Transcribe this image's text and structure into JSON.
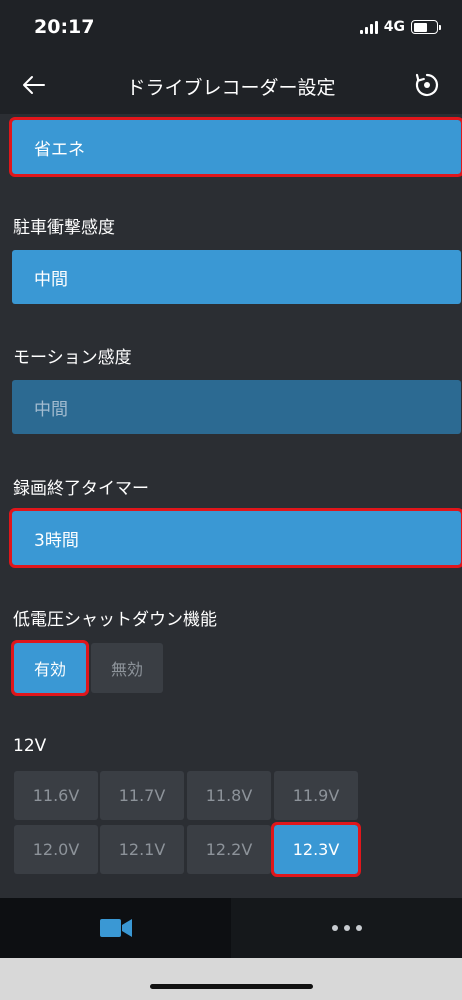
{
  "status_bar": {
    "time": "20:17",
    "network": "4G",
    "signal_bars": 4,
    "battery_level": 0.6
  },
  "nav": {
    "title": "ドライブレコーダー設定",
    "back_icon": "arrow-left-icon",
    "reset_icon": "reset-icon"
  },
  "settings": {
    "mode_value": "省エネ",
    "parking_sensitivity": {
      "label": "駐車衝撃感度",
      "value": "中間"
    },
    "motion_sensitivity": {
      "label": "モーション感度",
      "value": "中間"
    },
    "record_timer": {
      "label": "録画終了タイマー",
      "value": "3時間"
    },
    "low_voltage": {
      "label": "低電圧シャットダウン機能",
      "on_label": "有効",
      "off_label": "無効",
      "enabled": true
    },
    "voltage": {
      "label": "12V",
      "options": [
        "11.6V",
        "11.7V",
        "11.8V",
        "11.9V",
        "12.0V",
        "12.1V",
        "12.2V",
        "12.3V"
      ],
      "selected": "12.3V"
    }
  },
  "tabs": [
    {
      "name": "camera",
      "icon": "video-camera-icon",
      "active": true
    },
    {
      "name": "more",
      "icon": "more-dots-icon",
      "active": false
    }
  ],
  "colors": {
    "accent": "#3a98d4",
    "background": "#2b2e33",
    "highlight": "#e0161b"
  }
}
